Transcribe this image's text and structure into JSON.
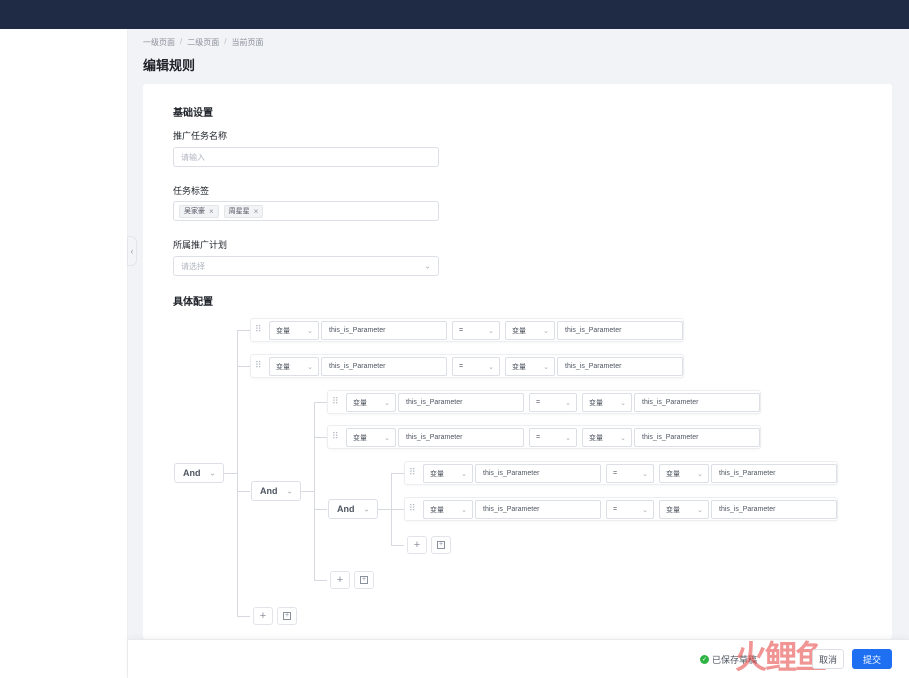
{
  "breadcrumb": [
    "一级页面",
    "二级页面",
    "当前页面"
  ],
  "page_title": "编辑规则",
  "basic": {
    "section_title": "基础设置",
    "task_name_label": "推广任务名称",
    "task_name_placeholder": "请输入",
    "task_tags_label": "任务标签",
    "tags": [
      "吴家豪",
      "周星星"
    ],
    "plan_label": "所属推广计划",
    "plan_placeholder": "请选择"
  },
  "config": {
    "section_title": "具体配置",
    "logic_label": "And",
    "rule": {
      "type": "变量",
      "param": "this_is_Parameter",
      "op": "=",
      "type2": "变量",
      "param2": "this_is_Parameter"
    }
  },
  "footer": {
    "saved_text": "已保存草稿",
    "cancel_label": "取消",
    "submit_label": "提交"
  },
  "watermark": "火鲤鱼"
}
